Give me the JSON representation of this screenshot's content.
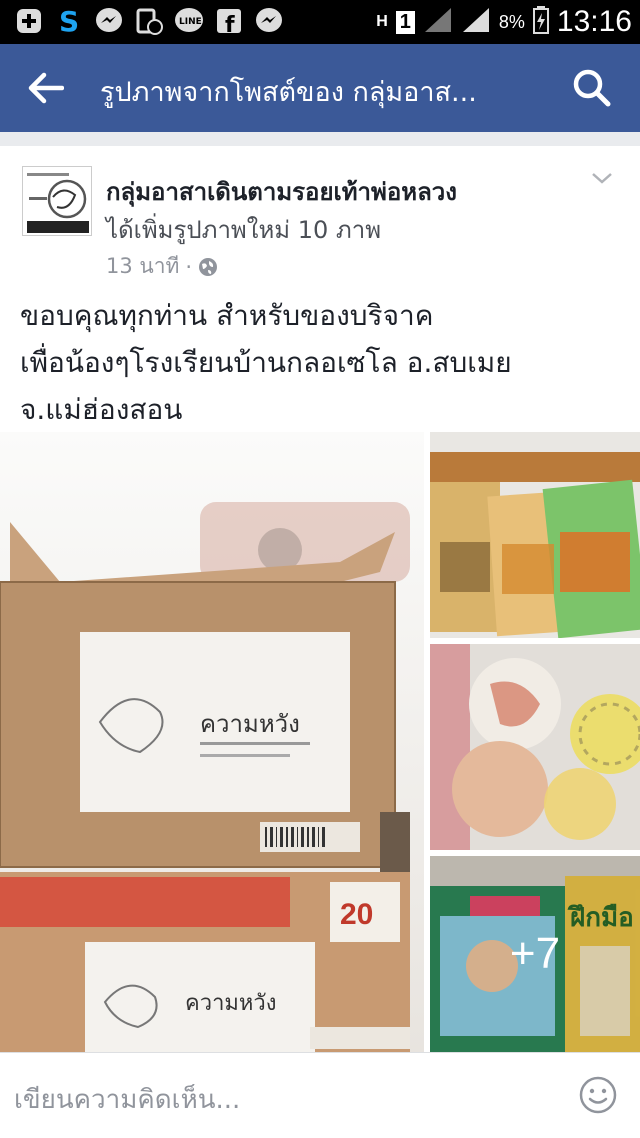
{
  "status_bar": {
    "icons": [
      "add-icon",
      "skype-icon",
      "messenger-icon",
      "call-log-icon",
      "line-icon",
      "facebook-icon",
      "messenger-icon"
    ],
    "network": "H",
    "sim": "1",
    "battery": "8%",
    "time": "13:16"
  },
  "app_bar": {
    "title": "รูปภาพจากโพสต์ของ กลุ่มอาส...",
    "back_icon": "arrow-left-icon",
    "search_icon": "search-icon",
    "color": "#3b5998"
  },
  "post": {
    "group_name": "กลุ่มอาสาเดินตามรอยเท้าพ่อหลวง",
    "action": "ได้เพิ่มรูปภาพใหม่ 10 ภาพ",
    "time": "13 นาที",
    "privacy_icon": "globe-icon",
    "menu_icon": "chevron-down-icon",
    "text_lines": [
      "ขอบคุณทุกท่าน สำหรับของบริจาค",
      "เพื่อน้องๆโรงเรียนบ้านกลอเซโล อ.สบเมย",
      "จ.แม่ฮ่องสอน"
    ],
    "photos": {
      "main_box_label_1": "ความหวัง",
      "main_box_label_2": "ความหวัง",
      "side_books_label": "ฝึกมือ",
      "more_count": "+7"
    }
  },
  "comment_bar": {
    "placeholder": "เขียนความคิดเห็น...",
    "emoji_icon": "smiley-icon"
  }
}
